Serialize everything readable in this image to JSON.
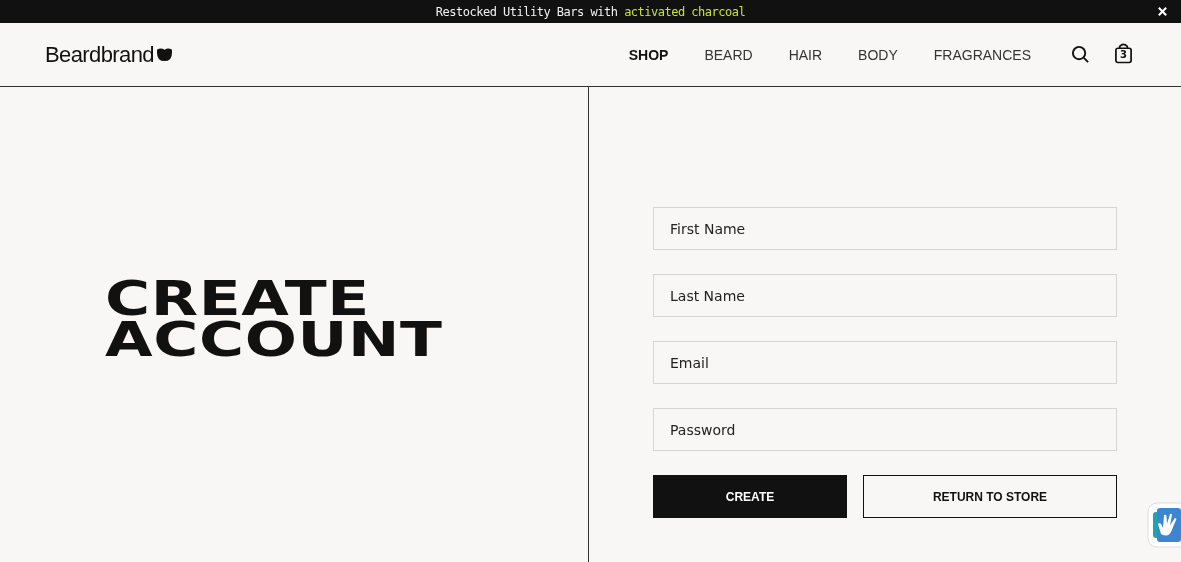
{
  "announcement": {
    "text": "Restocked Utility Bars with ",
    "link": "activated charcoal"
  },
  "header": {
    "logo": "Beardbrand",
    "nav": [
      {
        "label": "SHOP",
        "selected": true
      },
      {
        "label": "BEARD",
        "selected": false
      },
      {
        "label": "HAIR",
        "selected": false
      },
      {
        "label": "BODY",
        "selected": false
      },
      {
        "label": "FRAGRANCES",
        "selected": false
      }
    ],
    "cart_count": "3"
  },
  "title_lines": [
    "CREATE",
    "ACCOUNT"
  ],
  "fields": [
    {
      "placeholder": "First Name"
    },
    {
      "placeholder": "Last Name"
    },
    {
      "placeholder": "Email"
    },
    {
      "placeholder": "Password"
    }
  ],
  "buttons": [
    {
      "label": "CREATE",
      "kind": "primary"
    },
    {
      "label": "RETURN TO STORE",
      "kind": "secondary"
    }
  ]
}
